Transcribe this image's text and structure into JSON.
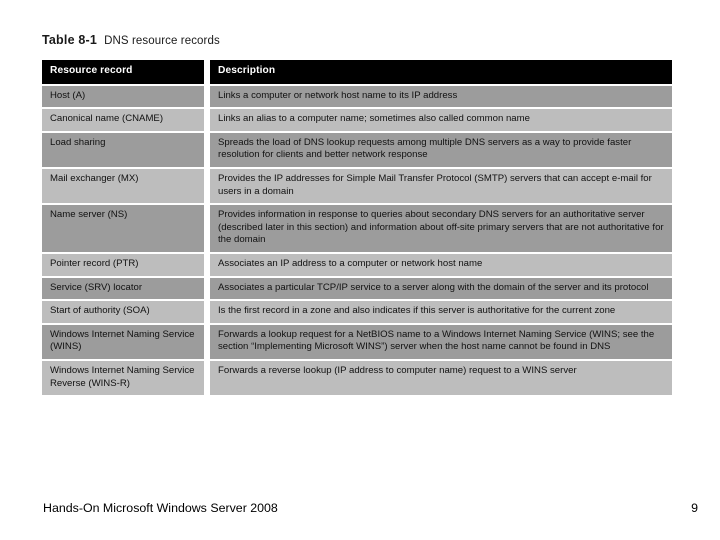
{
  "slide": {
    "caption_label": "Table 8-1",
    "caption_text": "DNS resource records"
  },
  "table": {
    "headers": {
      "record": "Resource record",
      "description": "Description"
    },
    "rows": [
      {
        "record": "Host (A)",
        "description": "Links a computer or network host name to its IP address"
      },
      {
        "record": "Canonical name (CNAME)",
        "description": "Links an alias to a computer name; sometimes also called common name"
      },
      {
        "record": "Load sharing",
        "description": "Spreads the load of DNS lookup requests among multiple DNS servers as a way to provide faster resolution for clients and better network response"
      },
      {
        "record": "Mail exchanger (MX)",
        "description": "Provides the IP addresses for Simple Mail Transfer Protocol (SMTP) servers that can accept e-mail for users in a domain"
      },
      {
        "record": "Name server (NS)",
        "description": "Provides information in response to queries about secondary DNS servers for an authoritative server (described later in this section) and information about off-site primary servers that are not authoritative for the domain"
      },
      {
        "record": "Pointer record (PTR)",
        "description": "Associates an IP address to a computer or network host name"
      },
      {
        "record": "Service (SRV) locator",
        "description": "Associates a particular TCP/IP service to a server along with the domain of the server and its protocol"
      },
      {
        "record": "Start of authority (SOA)",
        "description": "Is the first record in a zone and also indicates if this server is authoritative for the current zone"
      },
      {
        "record": "Windows Internet Naming Service (WINS)",
        "description": "Forwards a lookup request for a NetBIOS name to a Windows Internet Naming Service (WINS; see the section “Implementing Microsoft WINS”) server when the host name cannot be found in DNS"
      },
      {
        "record": "Windows Internet Naming Service Reverse (WINS-R)",
        "description": "Forwards a reverse lookup (IP address to computer name) request to a WINS server"
      }
    ]
  },
  "footer": {
    "title": "Hands-On Microsoft Windows Server 2008",
    "page_number": "9"
  },
  "colors": {
    "header_background": "#000000",
    "header_text": "#ffffff",
    "row_dark": "#9c9c9c",
    "row_light": "#bdbdbd",
    "slide_background": "#ffffff",
    "body_text": "#111111"
  }
}
